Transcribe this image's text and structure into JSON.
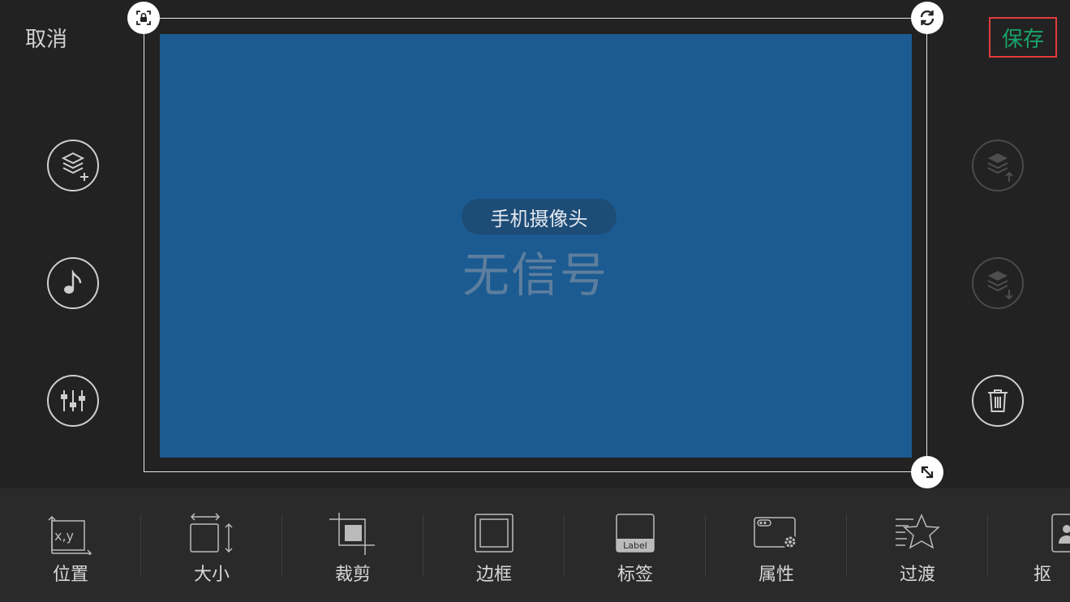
{
  "header": {
    "cancel_label": "取消",
    "save_label": "保存"
  },
  "preview": {
    "source_name": "手机摄像头",
    "status_text": "无信号"
  },
  "colors": {
    "save_text": "#19a36b",
    "save_outline": "#e23b3b",
    "video_bg": "#1b5b91",
    "background": "#222222"
  },
  "left_tools": [
    {
      "name": "add-layer",
      "icon": "layers-plus-icon"
    },
    {
      "name": "music",
      "icon": "music-note-icon"
    },
    {
      "name": "mixer",
      "icon": "sliders-icon"
    }
  ],
  "right_tools": [
    {
      "name": "layer-up",
      "icon": "layers-up-icon",
      "enabled": false
    },
    {
      "name": "layer-down",
      "icon": "layers-down-icon",
      "enabled": false
    },
    {
      "name": "delete",
      "icon": "trash-icon",
      "enabled": true
    }
  ],
  "toolbar": {
    "items": [
      {
        "label": "位置",
        "icon": "position-xy-icon",
        "icon_text": "x,y"
      },
      {
        "label": "大小",
        "icon": "resize-icon"
      },
      {
        "label": "裁剪",
        "icon": "crop-icon"
      },
      {
        "label": "边框",
        "icon": "border-icon"
      },
      {
        "label": "标签",
        "icon": "label-icon",
        "icon_text": "Label"
      },
      {
        "label": "属性",
        "icon": "properties-icon"
      },
      {
        "label": "过渡",
        "icon": "transition-star-icon"
      },
      {
        "label": "抠",
        "icon": "matting-icon"
      }
    ]
  }
}
